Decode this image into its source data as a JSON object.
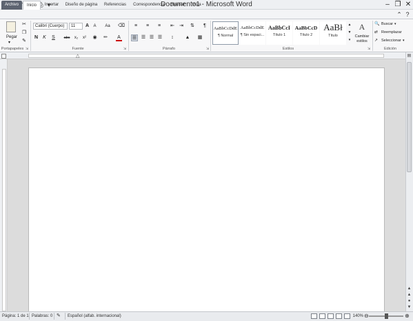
{
  "window": {
    "title": "Documento1 - Microsoft Word"
  },
  "quick_access": {
    "save_icon": "save-icon",
    "undo_icon": "undo-icon",
    "redo_icon": "redo-icon",
    "print_icon": "print-icon",
    "customize_icon": "chevron-down-icon"
  },
  "tabs": [
    {
      "label": "Archivo"
    },
    {
      "label": "Inicio"
    },
    {
      "label": "Insertar"
    },
    {
      "label": "Diseño de página"
    },
    {
      "label": "Referencias"
    },
    {
      "label": "Correspondencia"
    },
    {
      "label": "Revisar"
    },
    {
      "label": "Vista"
    }
  ],
  "ribbon": {
    "clipboard": {
      "paste_label": "Pegar",
      "group_label": "Portapapeles"
    },
    "font": {
      "font_name": "Calibri (Cuerpo)",
      "font_size": "11",
      "grow": "A",
      "shrink": "A",
      "case": "Aa",
      "bold": "N",
      "italic": "K",
      "underline": "S",
      "strike": "abc",
      "subscript": "x₂",
      "superscript": "x²",
      "color_a": "A",
      "group_label": "Fuente"
    },
    "paragraph": {
      "pilcrow": "¶",
      "group_label": "Párrafo"
    },
    "styles": {
      "items": [
        {
          "sample": "AaBbCcDdE",
          "name": "¶ Normal"
        },
        {
          "sample": "AaBbCcDdE",
          "name": "¶ Sin espaci..."
        },
        {
          "sample": "AaBbCcI",
          "name": "Título 1"
        },
        {
          "sample": "AaBbCcD",
          "name": "Título 2"
        },
        {
          "sample": "AaBł",
          "name": "Título"
        }
      ],
      "change_label_1": "Cambiar",
      "change_label_2": "estilos",
      "group_label": "Estilos"
    },
    "editing": {
      "find": "Buscar",
      "replace": "Reemplazar",
      "select": "Seleccionar",
      "group_label": "Edición"
    }
  },
  "status": {
    "page": "Página: 1 de 1",
    "words": "Palabras: 0",
    "language": "Español (alfab. internacional)",
    "zoom": "140%"
  }
}
